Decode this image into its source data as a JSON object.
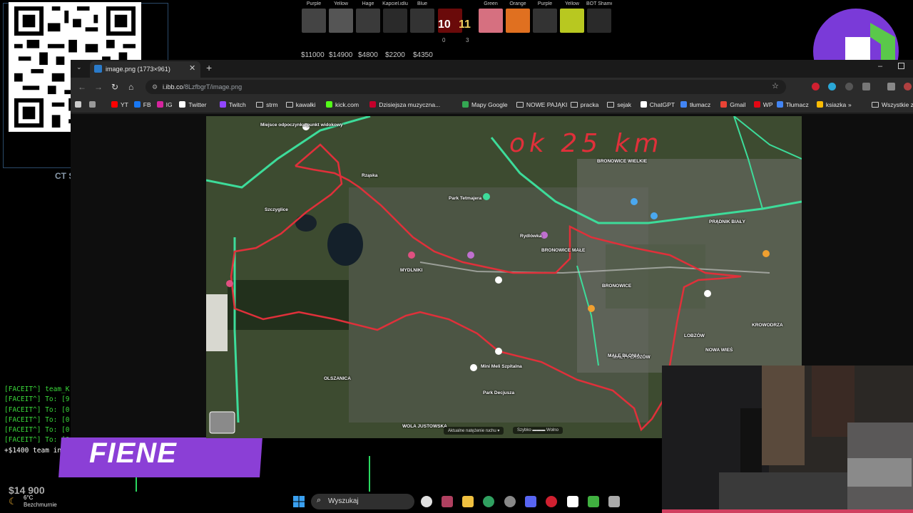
{
  "overlay": {
    "ct_label": "CT S",
    "hud": {
      "t_players": [
        {
          "name": "Purple",
          "money": "$11000"
        },
        {
          "name": "Yellow",
          "money": "$14900"
        },
        {
          "name": "Hage",
          "money": "$4800"
        },
        {
          "name": "Kapciel.idlu",
          "money": "$2200"
        },
        {
          "name": "Blue",
          "money": "$4350"
        }
      ],
      "ct_players": [
        {
          "name": "Green"
        },
        {
          "name": "Orange"
        },
        {
          "name": "Purple"
        },
        {
          "name": "Yellow"
        },
        {
          "name": "BOT Shamel..."
        }
      ],
      "score_t": "10",
      "score_ct": "11",
      "t_sub": "0",
      "ct_sub": "3"
    },
    "chat": [
      "[FACEIT^] team_K",
      "[FACEIT^] To: [9",
      "[FACEIT^] To: [0",
      "[FACEIT^] To: [0",
      "[FACEIT^] To: [0",
      "[FACEIT^] To: [0",
      "+$1400 team inc"
    ],
    "banner_text": "FIENE",
    "bottom_money": "$14 900"
  },
  "browser": {
    "tab_title": "image.png (1773×961)",
    "url_host": "i.ibb.co",
    "url_path": "/8LzfbgrT/image.png",
    "bookmarks": [
      {
        "label": "YT",
        "kind": "icon",
        "color": "#ff0000"
      },
      {
        "label": "FB",
        "kind": "icon",
        "color": "#1877f2"
      },
      {
        "label": "IG",
        "kind": "icon",
        "color": "#d6249f"
      },
      {
        "label": "Twitter",
        "kind": "icon",
        "color": "#ffffff"
      },
      {
        "label": "Twitch",
        "kind": "icon",
        "color": "#9146ff"
      },
      {
        "label": "strm",
        "kind": "folder"
      },
      {
        "label": "kawałki",
        "kind": "folder"
      },
      {
        "label": "kick.com",
        "kind": "icon",
        "color": "#53fc18"
      },
      {
        "label": "Dzisiejsza muzyczna...",
        "kind": "icon",
        "color": "#c4002b"
      },
      {
        "label": "Mapy Google",
        "kind": "icon",
        "color": "#34a853"
      },
      {
        "label": "NOWE PAJĄKI",
        "kind": "folder"
      },
      {
        "label": "pracka",
        "kind": "folder"
      },
      {
        "label": "sejak",
        "kind": "folder"
      },
      {
        "label": "ChatGPT",
        "kind": "icon",
        "color": "#ffffff"
      },
      {
        "label": "tłumacz",
        "kind": "icon",
        "color": "#4285f4"
      },
      {
        "label": "Gmail",
        "kind": "icon",
        "color": "#ea4335"
      },
      {
        "label": "WP",
        "kind": "icon",
        "color": "#e30613"
      },
      {
        "label": "Tłumacz",
        "kind": "icon",
        "color": "#4285f4"
      },
      {
        "label": "ksiazka",
        "kind": "icon",
        "color": "#fbbc04"
      }
    ],
    "all_bookmarks": "Wszystkie z"
  },
  "map": {
    "annotation": "ok 25 km",
    "places": [
      {
        "name": "Miejsce odpoczynku punkt widokowy"
      },
      {
        "name": "Rząska"
      },
      {
        "name": "Szczyglice"
      },
      {
        "name": "Park Tetmajera"
      },
      {
        "name": "MYDLNIKI"
      },
      {
        "name": "Rydlówka"
      },
      {
        "name": "BRONOWICE WIELKIE"
      },
      {
        "name": "BRONOWICE MAŁE"
      },
      {
        "name": "BRONOWICE"
      },
      {
        "name": "PRĄDNIK BIAŁY"
      },
      {
        "name": "MAŁY PŁASZÓW"
      },
      {
        "name": "BRONOWICE"
      },
      {
        "name": "WOLA JUSTOWSKA"
      },
      {
        "name": "OLSZANICA"
      },
      {
        "name": "Mini Meli Szpitalna"
      },
      {
        "name": "LOBZÓW"
      },
      {
        "name": "NOWA WIEŚ"
      },
      {
        "name": "KROWODRZA"
      },
      {
        "name": "MAŁE BŁONIA"
      },
      {
        "name": "Park Decjusza"
      }
    ],
    "traffic_label": "Aktualne natężenie ruchu ▾",
    "speed_label": "Szybko ▬▬▬ Wolno"
  },
  "taskbar": {
    "temperature": "6°C",
    "weather": "Bezchmurnie",
    "search_placeholder": "Wyszukaj"
  },
  "colors": {
    "route": "#e0303a",
    "road": "#3ddc9a",
    "accent_purple": "#8b3fd6"
  }
}
